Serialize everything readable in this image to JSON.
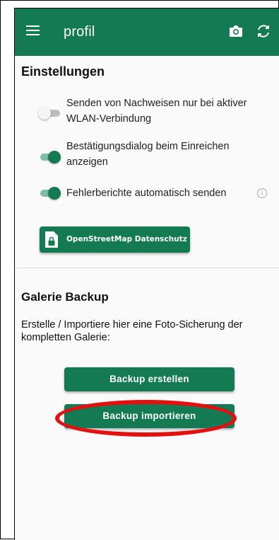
{
  "appbar": {
    "title": "profil",
    "icons": [
      "menu-icon",
      "camera-icon",
      "refresh-icon"
    ],
    "color": "#137a54"
  },
  "settings": {
    "title": "Einstellungen",
    "toggles": [
      {
        "label_line1": "Senden von Nachweisen nur bei aktiver",
        "label_line2": "WLAN-Verbindung",
        "on": false
      },
      {
        "label_line1": "Bestätigungsdialog beim Einreichen",
        "label_line2": "anzeigen",
        "on": true
      },
      {
        "label_line1": "Fehlerberichte automatisch senden",
        "label_line2": "",
        "on": true,
        "info": "i"
      }
    ],
    "osm_button": "OpenStreetMap Datenschutz"
  },
  "backup": {
    "title": "Galerie Backup",
    "description": "Erstelle / Importiere hier eine Foto-Sicherung der kompletten Galerie:",
    "create_button": "Backup erstellen",
    "import_button": "Backup importieren"
  },
  "colors": {
    "accent": "#137a54",
    "highlight": "#e41010"
  }
}
